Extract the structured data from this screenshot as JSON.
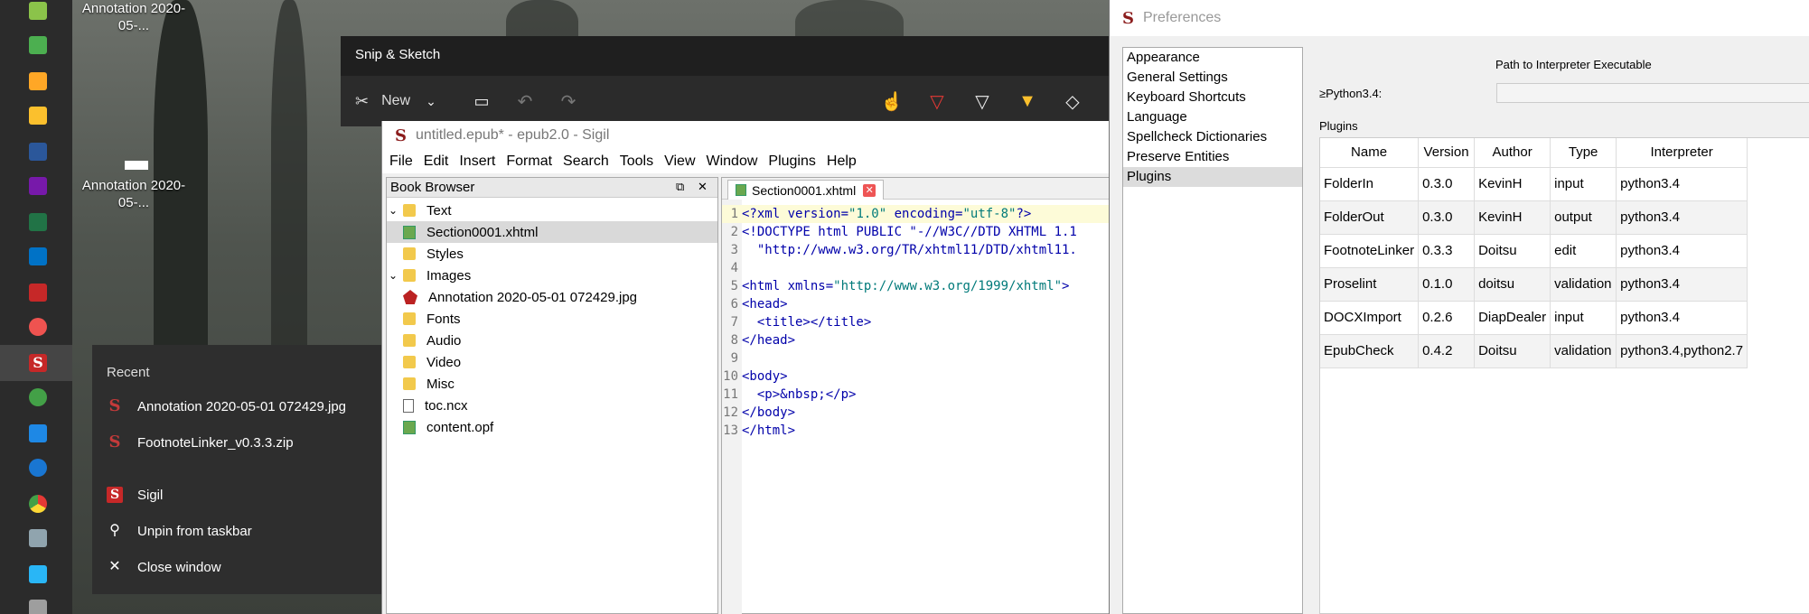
{
  "desktop": {
    "icons": [
      {
        "label": "Annotation 2020-05-..."
      },
      {
        "label": "Annotation 2020-05-..."
      }
    ]
  },
  "taskbar": {
    "icons": [
      "app-icon",
      "photos-icon",
      "library-icon",
      "file-explorer-icon",
      "word-icon",
      "onenote-icon",
      "excel-icon",
      "outlook-icon",
      "puzzle-icon",
      "reload-icon",
      "sigil-icon",
      "refresh-icon",
      "monitor-icon",
      "edge-icon",
      "chrome-icon",
      "image-editor-icon",
      "arrow-app-icon",
      "calculator-icon"
    ]
  },
  "jumplist": {
    "section_title": "Recent",
    "recent": [
      "Annotation 2020-05-01 072429.jpg",
      "FootnoteLinker_v0.3.3.zip"
    ],
    "actions": [
      {
        "label": "Sigil",
        "icon": "sigil-icon"
      },
      {
        "label": "Unpin from taskbar",
        "icon": "unpin-icon"
      },
      {
        "label": "Close window",
        "icon": "close-icon"
      }
    ]
  },
  "snip": {
    "title": "Snip & Sketch",
    "new_label": "New"
  },
  "sigil": {
    "title": "untitled.epub* - epub2.0 - Sigil",
    "menus": [
      "File",
      "Edit",
      "Insert",
      "Format",
      "Search",
      "Tools",
      "View",
      "Window",
      "Plugins",
      "Help"
    ],
    "book_browser": {
      "title": "Book Browser",
      "items": [
        {
          "label": "Text"
        },
        {
          "label": "Section0001.xhtml"
        },
        {
          "label": "Styles"
        },
        {
          "label": "Images"
        },
        {
          "label": "Annotation 2020-05-01 072429.jpg"
        },
        {
          "label": "Fonts"
        },
        {
          "label": "Audio"
        },
        {
          "label": "Video"
        },
        {
          "label": "Misc"
        },
        {
          "label": "toc.ncx"
        },
        {
          "label": "content.opf"
        }
      ]
    },
    "editor": {
      "tab_label": "Section0001.xhtml",
      "lines": [
        {
          "n": "1",
          "segments": [
            {
              "c": "tag",
              "t": "<?xml "
            },
            {
              "c": "tag",
              "t": "version="
            },
            {
              "c": "str",
              "t": "\"1.0\""
            },
            {
              "c": "tag",
              "t": " encoding="
            },
            {
              "c": "str",
              "t": "\"utf-8\""
            },
            {
              "c": "tag",
              "t": "?>"
            }
          ]
        },
        {
          "n": "2",
          "segments": [
            {
              "c": "tag",
              "t": "<!DOCTYPE html PUBLIC \"-//W3C//DTD XHTML 1.1"
            }
          ]
        },
        {
          "n": "3",
          "segments": [
            {
              "c": "tag",
              "t": "  \"http://www.w3.org/TR/xhtml11/DTD/xhtml11."
            }
          ]
        },
        {
          "n": "4",
          "segments": []
        },
        {
          "n": "5",
          "segments": [
            {
              "c": "tag",
              "t": "<html xmlns="
            },
            {
              "c": "str",
              "t": "\"http://www.w3.org/1999/xhtml\""
            },
            {
              "c": "tag",
              "t": ">"
            }
          ]
        },
        {
          "n": "6",
          "segments": [
            {
              "c": "tag",
              "t": "<head>"
            }
          ]
        },
        {
          "n": "7",
          "segments": [
            {
              "c": "tag",
              "t": "  <title></title>"
            }
          ]
        },
        {
          "n": "8",
          "segments": [
            {
              "c": "tag",
              "t": "</head>"
            }
          ]
        },
        {
          "n": "9",
          "segments": []
        },
        {
          "n": "10",
          "segments": [
            {
              "c": "tag",
              "t": "<body>"
            }
          ]
        },
        {
          "n": "11",
          "segments": [
            {
              "c": "tag",
              "t": "  <p>&nbsp;</p>"
            }
          ]
        },
        {
          "n": "12",
          "segments": [
            {
              "c": "tag",
              "t": "</body>"
            }
          ]
        },
        {
          "n": "13",
          "segments": [
            {
              "c": "tag",
              "t": "</html>"
            }
          ]
        }
      ]
    }
  },
  "preferences": {
    "title": "Preferences",
    "categories": [
      "Appearance",
      "General Settings",
      "Keyboard Shortcuts",
      "Language",
      "Spellcheck Dictionaries",
      "Preserve Entities",
      "Plugins"
    ],
    "selected_category": "Plugins",
    "path_label": "Path to Interpreter Executable",
    "python_label": "≥Python3.4:",
    "python_value": "",
    "plugins_label": "Plugins",
    "columns": [
      "Name",
      "Version",
      "Author",
      "Type",
      "Interpreter"
    ],
    "rows": [
      [
        "FolderIn",
        "0.3.0",
        "KevinH",
        "input",
        "python3.4"
      ],
      [
        "FolderOut",
        "0.3.0",
        "KevinH",
        "output",
        "python3.4"
      ],
      [
        "FootnoteLinker",
        "0.3.3",
        "Doitsu",
        "edit",
        "python3.4"
      ],
      [
        "Proselint",
        "0.1.0",
        "doitsu",
        "validation",
        "python3.4"
      ],
      [
        "DOCXImport",
        "0.2.6",
        "DiapDealer",
        "input",
        "python3.4"
      ],
      [
        "EpubCheck",
        "0.4.2",
        "Doitsu",
        "validation",
        "python3.4,python2.7"
      ]
    ]
  }
}
